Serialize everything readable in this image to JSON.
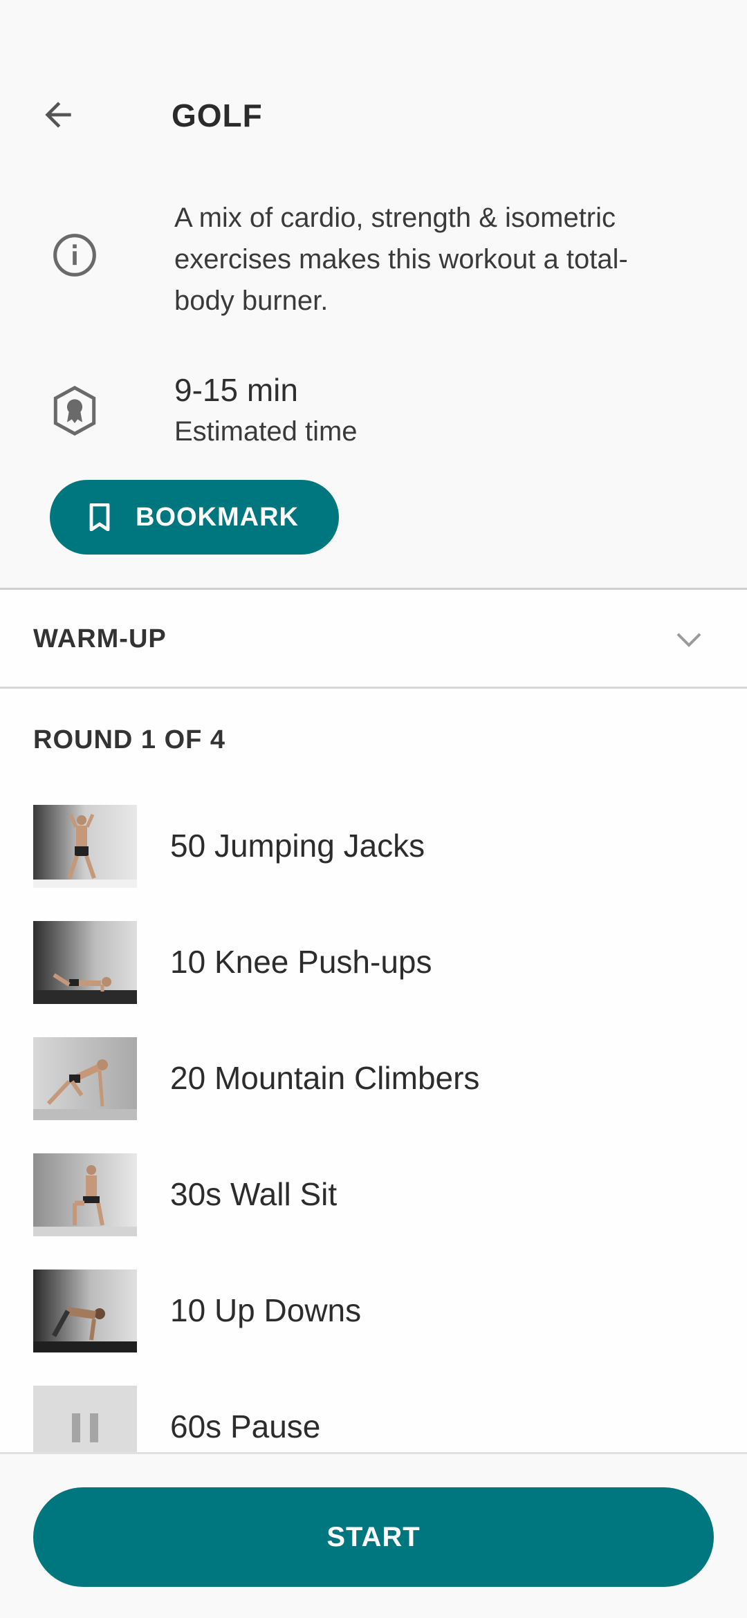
{
  "header": {
    "title": "GOLF",
    "back_icon": "arrow-left-icon"
  },
  "info": {
    "description": "A mix of cardio, strength & isometric exercises makes this workout a total-body burner.",
    "time_value": "9-15 min",
    "time_label": "Estimated time"
  },
  "bookmark": {
    "label": "BOOKMARK"
  },
  "sections": {
    "warmup_label": "WARM-UP",
    "round_label": "ROUND 1 OF 4"
  },
  "exercises": [
    {
      "name": "50 Jumping Jacks",
      "thumb": "jumping-jacks"
    },
    {
      "name": "10 Knee Push-ups",
      "thumb": "knee-pushups"
    },
    {
      "name": "20 Mountain Climbers",
      "thumb": "mountain-climbers"
    },
    {
      "name": "30s Wall Sit",
      "thumb": "wall-sit"
    },
    {
      "name": "10 Up Downs",
      "thumb": "up-downs"
    },
    {
      "name": "60s Pause",
      "thumb": "pause-icon"
    }
  ],
  "footer": {
    "start_label": "START"
  },
  "colors": {
    "accent": "#00777f",
    "background": "#f9f9f9",
    "divider": "#d6d6d6"
  }
}
